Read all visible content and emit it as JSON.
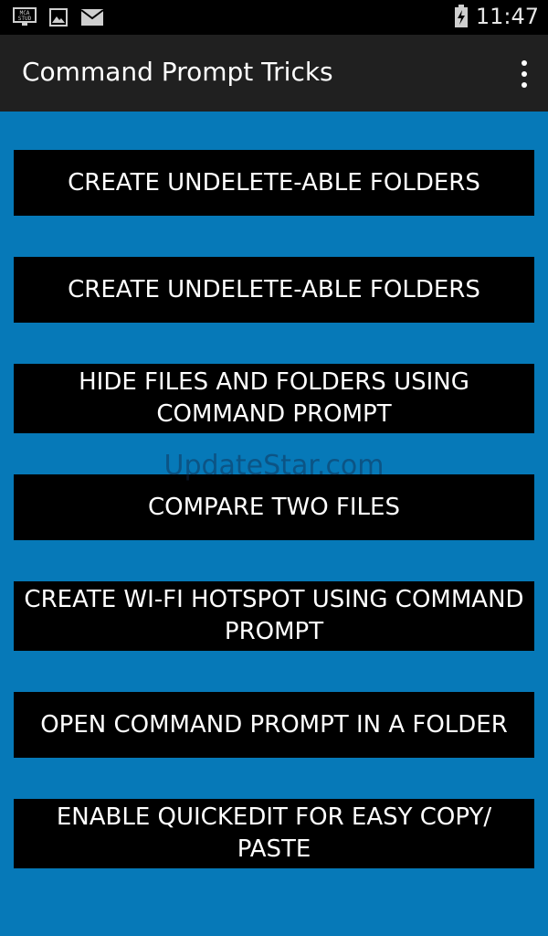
{
  "status_bar": {
    "time": "11:47",
    "left_icons": [
      "mca-stud-icon",
      "image-icon",
      "mail-icon"
    ],
    "right_icons": [
      "battery-charging-icon"
    ]
  },
  "app_bar": {
    "title": "Command Prompt Tricks",
    "overflow_icon": "more-vert-icon"
  },
  "menu": {
    "items": [
      {
        "label": "CREATE UNDELETE-ABLE FOLDERS"
      },
      {
        "label": "CREATE UNDELETE-ABLE FOLDERS"
      },
      {
        "label": "HIDE FILES AND FOLDERS USING COMMAND PROMPT"
      },
      {
        "label": "COMPARE TWO FILES"
      },
      {
        "label": "CREATE WI-FI HOTSPOT USING COMMAND PROMPT"
      },
      {
        "label": "OPEN COMMAND PROMPT IN A FOLDER"
      },
      {
        "label": "ENABLE QUICKEDIT FOR EASY COPY/ PASTE"
      }
    ]
  },
  "watermark": "UpdateStar.com",
  "colors": {
    "background": "#0679b8",
    "button": "#000000",
    "app_bar": "#202020"
  }
}
